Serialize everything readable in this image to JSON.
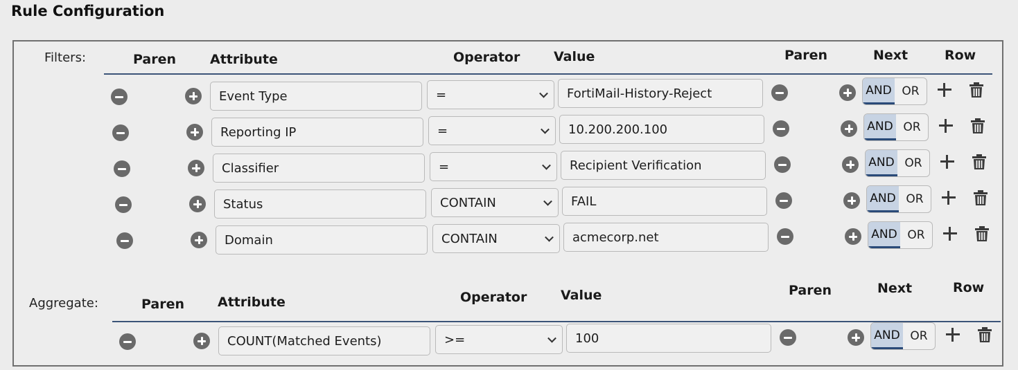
{
  "page": {
    "title": "Rule Configuration"
  },
  "filters": {
    "label": "Filters:",
    "headers": {
      "paren_left": "Paren",
      "attribute": "Attribute",
      "operator": "Operator",
      "value": "Value",
      "paren_right": "Paren",
      "next": "Next",
      "row": "Row"
    },
    "rows": [
      {
        "attribute": "Event Type",
        "operator": "=",
        "value": "FortiMail-History-Reject",
        "next_and": "AND",
        "next_or": "OR",
        "next_selected": "AND"
      },
      {
        "attribute": "Reporting IP",
        "operator": "=",
        "value": "10.200.200.100",
        "next_and": "AND",
        "next_or": "OR",
        "next_selected": "AND"
      },
      {
        "attribute": "Classifier",
        "operator": "=",
        "value": "Recipient Verification",
        "next_and": "AND",
        "next_or": "OR",
        "next_selected": "AND"
      },
      {
        "attribute": "Status",
        "operator": "CONTAIN",
        "value": "FAIL",
        "next_and": "AND",
        "next_or": "OR",
        "next_selected": "AND"
      },
      {
        "attribute": "Domain",
        "operator": "CONTAIN",
        "value": "acmecorp.net",
        "next_and": "AND",
        "next_or": "OR",
        "next_selected": "AND"
      }
    ]
  },
  "aggregate": {
    "label": "Aggregate:",
    "headers": {
      "paren_left": "Paren",
      "attribute": "Attribute",
      "operator": "Operator",
      "value": "Value",
      "paren_right": "Paren",
      "next": "Next",
      "row": "Row"
    },
    "rows": [
      {
        "attribute": "COUNT(Matched Events)",
        "operator": ">=",
        "value": "100",
        "next_and": "AND",
        "next_or": "OR",
        "next_selected": "AND"
      }
    ]
  },
  "icons": {
    "remove_paren": "minus-circle-icon",
    "add_paren": "plus-circle-icon",
    "add_row": "plus-icon",
    "delete_row": "trash-icon"
  },
  "colors": {
    "accent": "#2a4a78",
    "divider": "#3b5478",
    "toggle_selected_bg": "#c7d3e3",
    "button_gray": "#6a6a6a"
  }
}
